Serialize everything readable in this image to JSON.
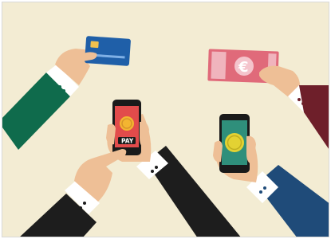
{
  "illustration": {
    "background_color": "#f3ecd3",
    "phone_left": {
      "button_label": "PAY",
      "screen_color": "#e24b4b",
      "coin_color": "#f3b531"
    },
    "phone_right": {
      "screen_color": "#2f8f7b",
      "coin_color": "#e3d233"
    },
    "banknote": {
      "symbol": "€",
      "color": "#e06a7a"
    },
    "credit_card": {
      "color": "#1f5fa8",
      "chip_color": "#f2c14e"
    },
    "sleeve_colors": {
      "green": "#0f6b4c",
      "navy": "#1f4b79",
      "maroon": "#6e1f2a",
      "black": "#1d1d1d"
    },
    "icons": [
      "credit-card-icon",
      "banknote-icon",
      "smartphone-icon",
      "coin-icon",
      "hand-icon"
    ]
  }
}
